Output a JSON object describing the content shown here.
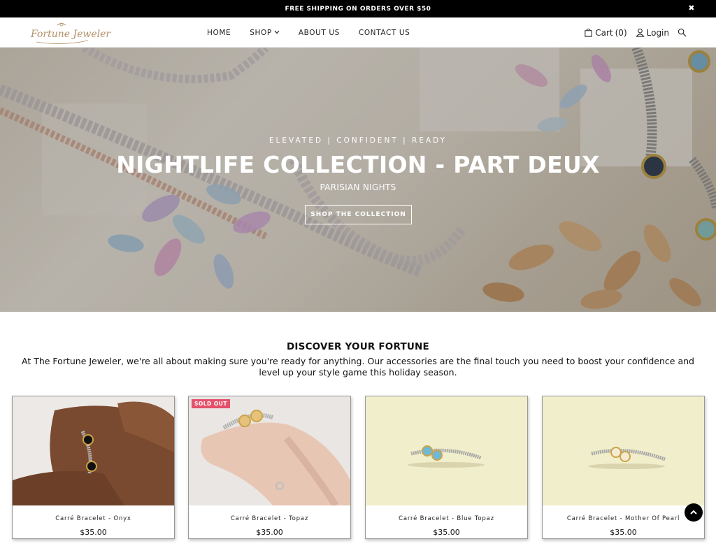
{
  "announcement": {
    "text": "FREE SHIPPING ON ORDERS OVER $50",
    "close_label": "✖"
  },
  "header": {
    "logo_text": "Fortune Jeweler",
    "nav": [
      {
        "label": "HOME"
      },
      {
        "label": "SHOP"
      },
      {
        "label": "ABOUT US"
      },
      {
        "label": "CONTACT US"
      }
    ],
    "cart_label": "Cart",
    "cart_count": "(0)",
    "login_label": "Login"
  },
  "hero": {
    "tagline": "ELEVATED | CONFIDENT | READY",
    "title": "NIGHTLIFE COLLECTION - PART DEUX",
    "subtitle": "PARISIAN NIGHTS",
    "button_label": "SHOP THE COLLECTION"
  },
  "intro": {
    "title": "DISCOVER YOUR FORTUNE",
    "text": "At The Fortune Jeweler, we're all about making sure you're ready for anything. Our accessories are the final touch you need to boost your confidence and level up your style game this holiday season."
  },
  "products": [
    {
      "name": "Carré Bracelet - Onyx",
      "price": "$35.00",
      "badge": ""
    },
    {
      "name": "Carré Bracelet - Topaz",
      "price": "$35.00",
      "badge": "SOLD OUT"
    },
    {
      "name": "Carré Bracelet - Blue Topaz",
      "price": "$35.00",
      "badge": ""
    },
    {
      "name": "Carré Bracelet - Mother Of Pearl",
      "price": "$35.00",
      "badge": ""
    }
  ],
  "colors": {
    "accent_gold": "#b3916a",
    "badge_pink": "#e4516b",
    "announcement_bg": "#000000"
  },
  "icons": [
    "close-icon",
    "chevron-down-icon",
    "cart-icon",
    "user-icon",
    "search-icon",
    "arrow-up-icon"
  ]
}
